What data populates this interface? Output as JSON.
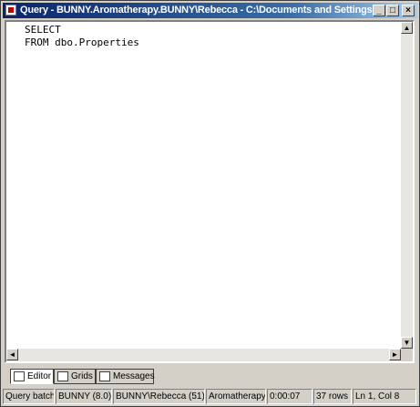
{
  "window": {
    "title": "Query - BUNNY.Aromatherapy.BUNNY\\Rebecca - C:\\Documents and Settings...",
    "minimize_glyph": "_",
    "maximize_glyph": "□",
    "close_glyph": "×"
  },
  "editor": {
    "lines": [
      "SELECT",
      "FROM dbo.Properties"
    ]
  },
  "scroll": {
    "up": "▲",
    "down": "▼",
    "left": "◄",
    "right": "►"
  },
  "tabs": [
    {
      "label": "Editor",
      "active": true
    },
    {
      "label": "Grids",
      "active": false
    },
    {
      "label": "Messages",
      "active": false
    }
  ],
  "status": {
    "mode": "Query batch",
    "server": "BUNNY (8.0)",
    "user": "BUNNY\\Rebecca (51)",
    "database": "Aromatherapy",
    "elapsed": "0:00:07",
    "rows": "37 rows",
    "position": "Ln 1, Col 8"
  }
}
